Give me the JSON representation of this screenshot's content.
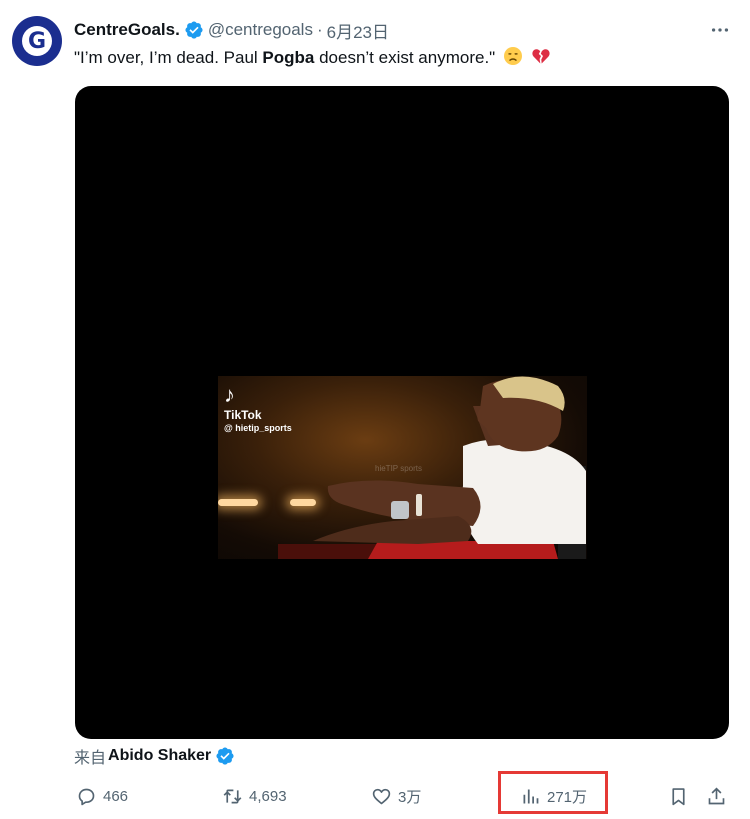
{
  "author": {
    "display_name": "CentreGoals.",
    "handle": "@centregoals",
    "date": "6月23日",
    "avatar_letter": "G",
    "avatar_color": "#1b2e8f",
    "verified_color": "#1d9bf0"
  },
  "tweet": {
    "text_before": "\"I’m over, I’m dead. Paul ",
    "text_bold": "Pogba",
    "text_after": " doesn’t exist anymore.\""
  },
  "media": {
    "tiktok_brand": "TikTok",
    "tiktok_handle": "@ hietip_sports",
    "watermark": "hieTIP sports"
  },
  "attribution": {
    "prefix": "来自",
    "source": "Abido Shaker"
  },
  "actions": {
    "replies": "466",
    "reposts": "4,693",
    "likes": "3万",
    "views": "271万"
  },
  "highlight_color": "#e53935"
}
